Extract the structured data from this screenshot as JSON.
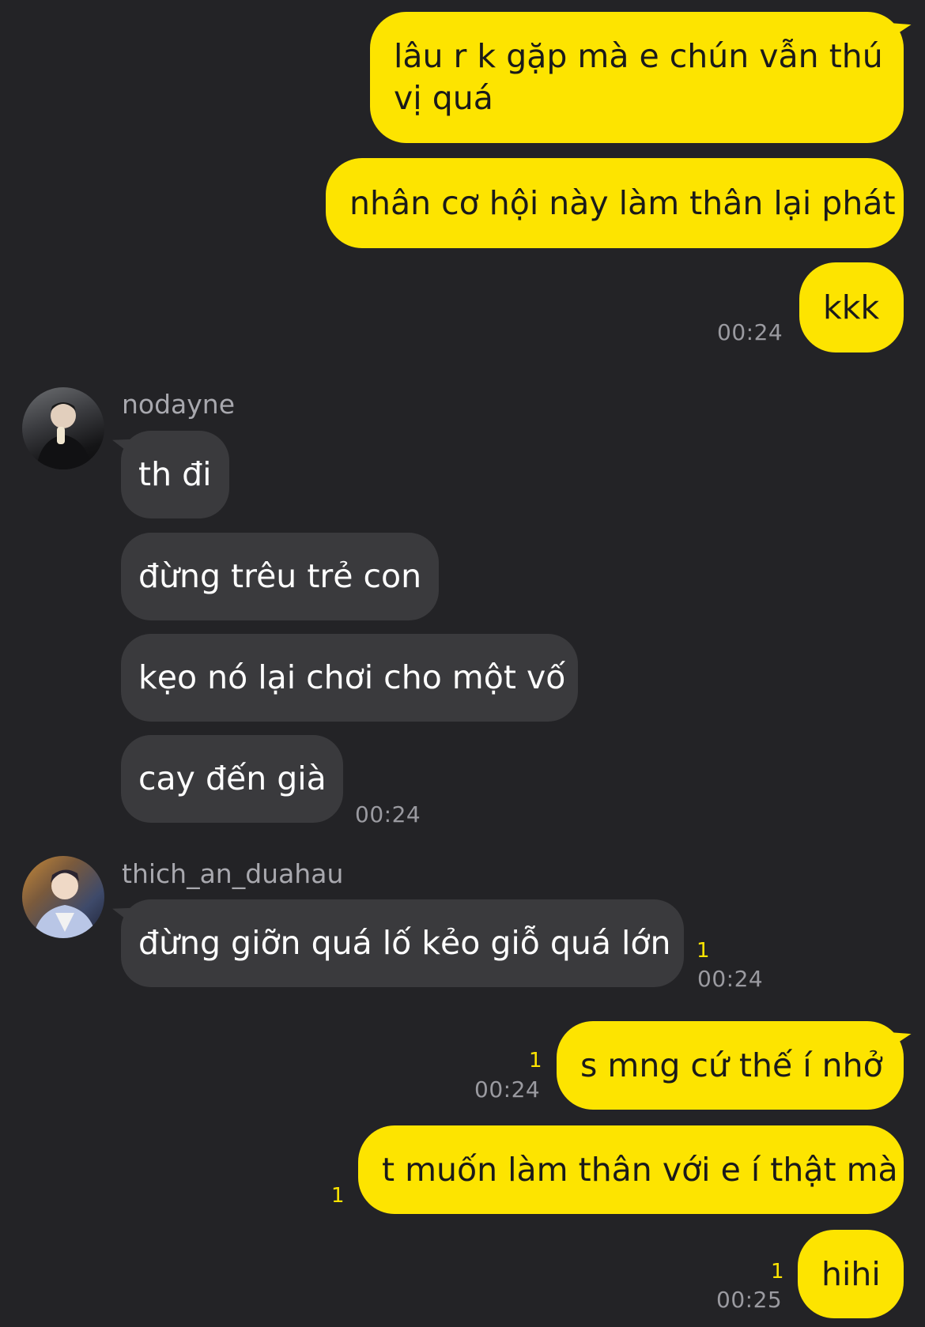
{
  "messages": {
    "m1": {
      "text": "lâu r k gặp mà e chún vẫn thú\nvị quá"
    },
    "m2": {
      "text": "nhân cơ hội này làm thân lại phát"
    },
    "m3": {
      "text": "kkk",
      "time": "00:24"
    },
    "g1": {
      "sender": "nodayne",
      "avatar": "avatar-nodayne",
      "items": [
        "th đi",
        "đừng trêu trẻ con",
        "kẹo nó lại chơi cho một vố",
        "cay đến già"
      ],
      "time": "00:24"
    },
    "g2": {
      "sender": "thich_an_duahau",
      "avatar": "avatar-thich-an-duahau",
      "text": "đừng giỡn quá lố kẻo giỗ quá lớn",
      "unread": "1",
      "time": "00:24"
    },
    "m4": {
      "text": "s mng cứ thế í nhở",
      "unread": "1",
      "time": "00:24"
    },
    "m5": {
      "text": "t muốn làm thân với e í thật mà",
      "unread": "1"
    },
    "m6": {
      "text": "hihi",
      "unread": "1",
      "time": "00:25"
    }
  },
  "colors": {
    "background": "#232326",
    "my_bubble": "#fde400",
    "their_bubble": "#3a3a3d",
    "timestamp": "#9a9aa0",
    "unread_count": "#fde400",
    "sender_name": "#a8a8ae"
  }
}
